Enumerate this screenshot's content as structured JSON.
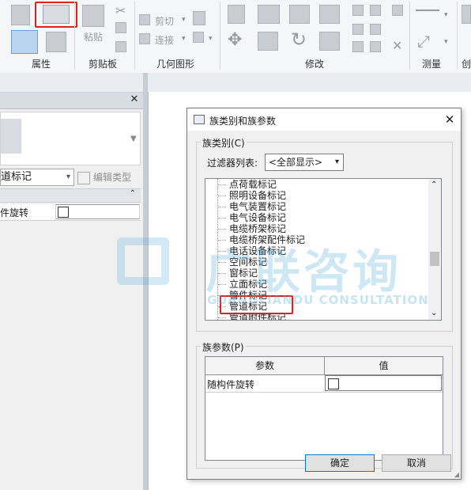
{
  "ribbon": {
    "groups": {
      "properties": "属性",
      "clipboard": "剪贴板",
      "geometry": "几何图形",
      "modify": "修改",
      "measure": "测量",
      "create_partial": "创"
    },
    "clipboard": {
      "paste_label": "粘贴"
    },
    "geometry": {
      "cut_label": "剪切",
      "join_label": "连接"
    }
  },
  "properties_panel": {
    "type_selector": "道标记",
    "edit_type_label": "编辑类型",
    "rows": [
      {
        "name": "件旋转",
        "checked": false
      }
    ]
  },
  "dialog": {
    "title": "族类别和族参数",
    "family_category_label": "族类别(C)",
    "filter_label": "过滤器列表:",
    "filter_value": "<全部显示>",
    "categories": [
      "点荷载标记",
      "照明设备标记",
      "电气装置标记",
      "电气设备标记",
      "电缆桥架标记",
      "电缆桥架配件标记",
      "电话设备标记",
      "空间标记",
      "窗标记",
      "立面标记",
      "管件标记",
      "管道标记",
      "管道附件标记"
    ],
    "selected_category": "管道标记",
    "family_params_label": "族参数(P)",
    "param_table": {
      "headers": [
        "参数",
        "值"
      ],
      "rows": [
        {
          "name": "随构件旋转",
          "checked": false
        }
      ]
    },
    "ok_label": "确定",
    "cancel_label": "取消"
  },
  "watermark": {
    "main": "广联咨询",
    "sub": "GUANGLIANDU CONSULTATION"
  },
  "colors": {
    "highlight_red": "#e02020",
    "accent_blue": "#3b7fc4"
  }
}
